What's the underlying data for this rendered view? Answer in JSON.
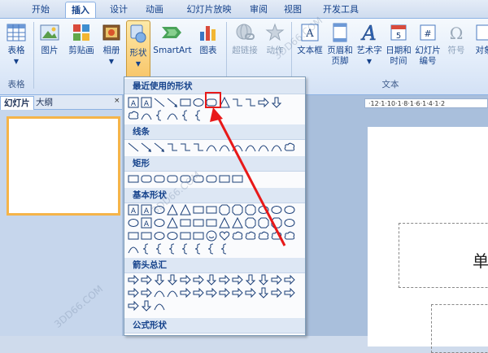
{
  "tabs": [
    "开始",
    "插入",
    "设计",
    "动画",
    "幻灯片放映",
    "审阅",
    "视图",
    "开发工具"
  ],
  "active_tab": "插入",
  "ribbon": {
    "table": "表格",
    "picture": "图片",
    "clipart": "剪贴画",
    "album": "相册",
    "shapes": "形状",
    "smartart": "SmartArt",
    "chart": "图表",
    "hyperlink": "超链接",
    "action": "动作",
    "textbox": "文本框",
    "header_footer_1": "页眉和",
    "header_footer_2": "页脚",
    "wordart": "艺术字",
    "datetime_1": "日期和",
    "datetime_2": "时间",
    "slide_no_1": "幻灯片",
    "slide_no_2": "编号",
    "symbol": "符号",
    "object": "对象",
    "group_table": "表格",
    "group_text": "文本"
  },
  "panel": {
    "tab_slides": "幻灯片",
    "tab_outline": "大纲"
  },
  "ruler_text": "·12·1·10·1·8·1·6·1·4·1·2",
  "slide_char": "单",
  "menu": {
    "recent": "最近使用的形状",
    "lines": "线条",
    "rect": "矩形",
    "basic": "基本形状",
    "arrows": "箭头总汇",
    "formula": "公式形状"
  },
  "watermarks": [
    "3DD66.COM",
    "3DD66.COM",
    "3DD66.COM"
  ]
}
